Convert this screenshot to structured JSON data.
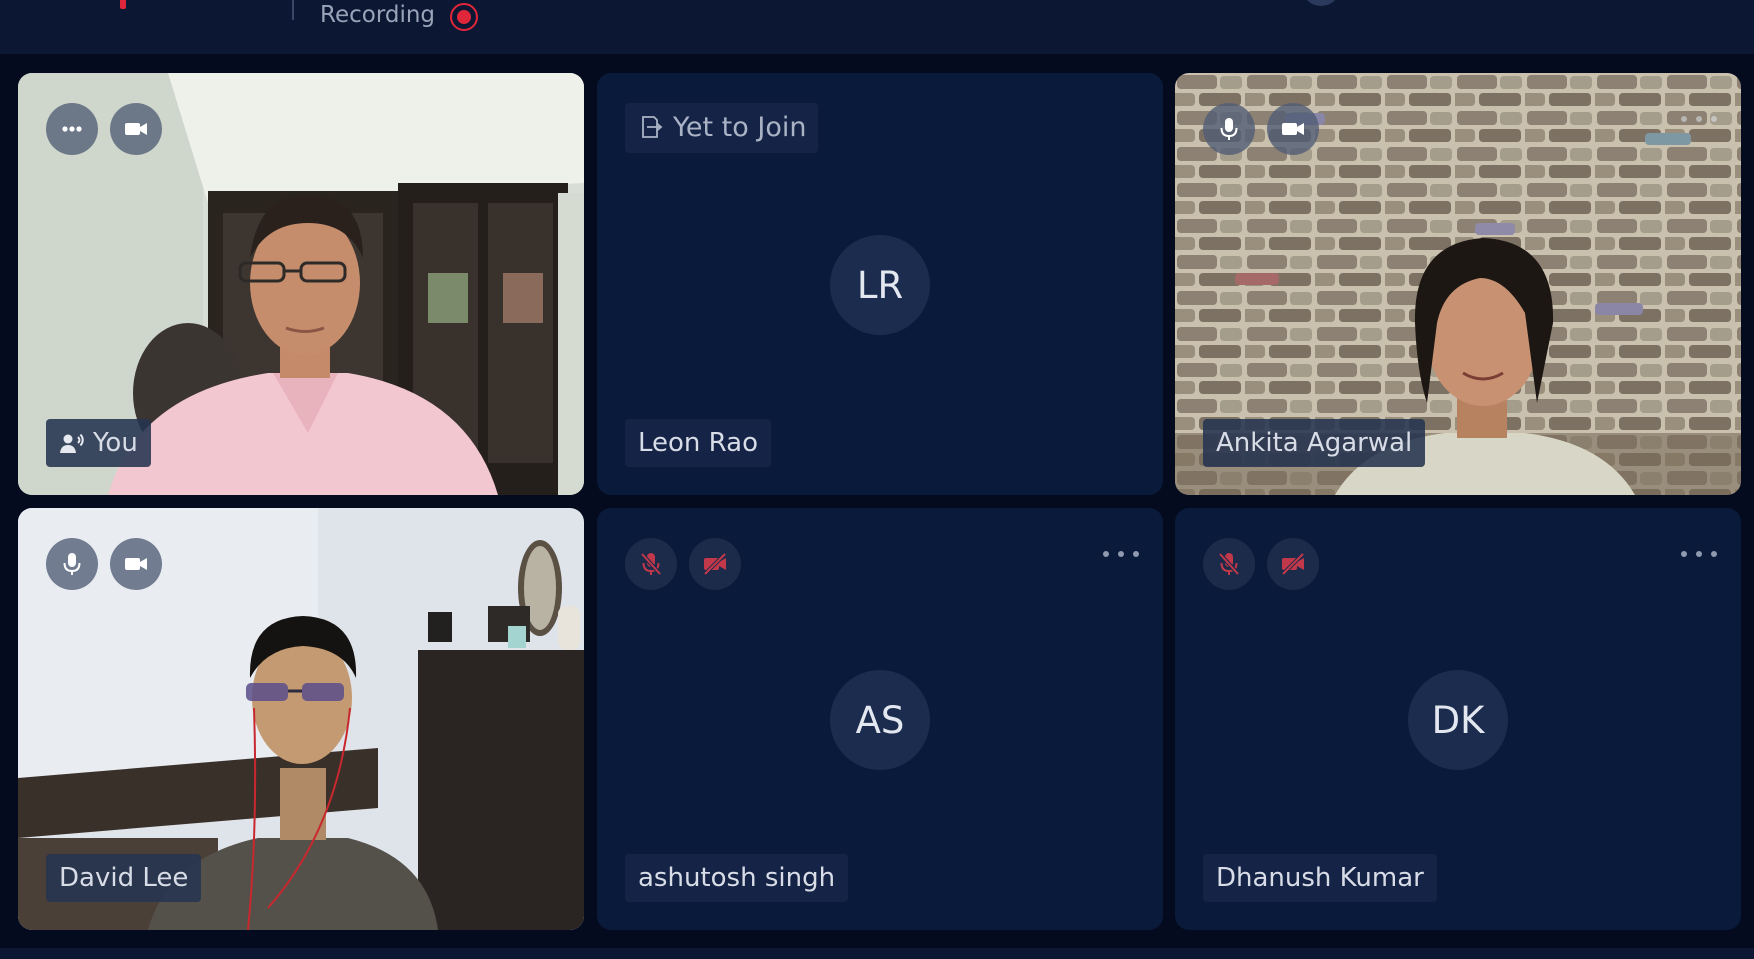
{
  "header": {
    "recording_label": "Recording"
  },
  "participants": [
    {
      "name": "You",
      "video": true,
      "controls": [
        "more-icon",
        "camera-icon"
      ],
      "speaking": true
    },
    {
      "name": "Leon Rao",
      "status": "Yet to Join",
      "initials": "LR",
      "video": false
    },
    {
      "name": "Ankita Agarwal",
      "video": true,
      "controls": [
        "microphone-icon",
        "camera-icon"
      ]
    },
    {
      "name": "David Lee",
      "video": true,
      "controls": [
        "microphone-icon",
        "camera-icon"
      ]
    },
    {
      "name": "ashutosh singh",
      "initials": "AS",
      "video": false,
      "controls": [
        "microphone-muted-icon",
        "camera-off-icon"
      ]
    },
    {
      "name": "Dhanush Kumar",
      "initials": "DK",
      "video": false,
      "controls": [
        "microphone-muted-icon",
        "camera-off-icon"
      ]
    }
  ],
  "colors": {
    "background": "#040b1f",
    "tile": "#0a1a3a",
    "recording_red": "#e0263a",
    "muted_icon": "#c0384a"
  }
}
